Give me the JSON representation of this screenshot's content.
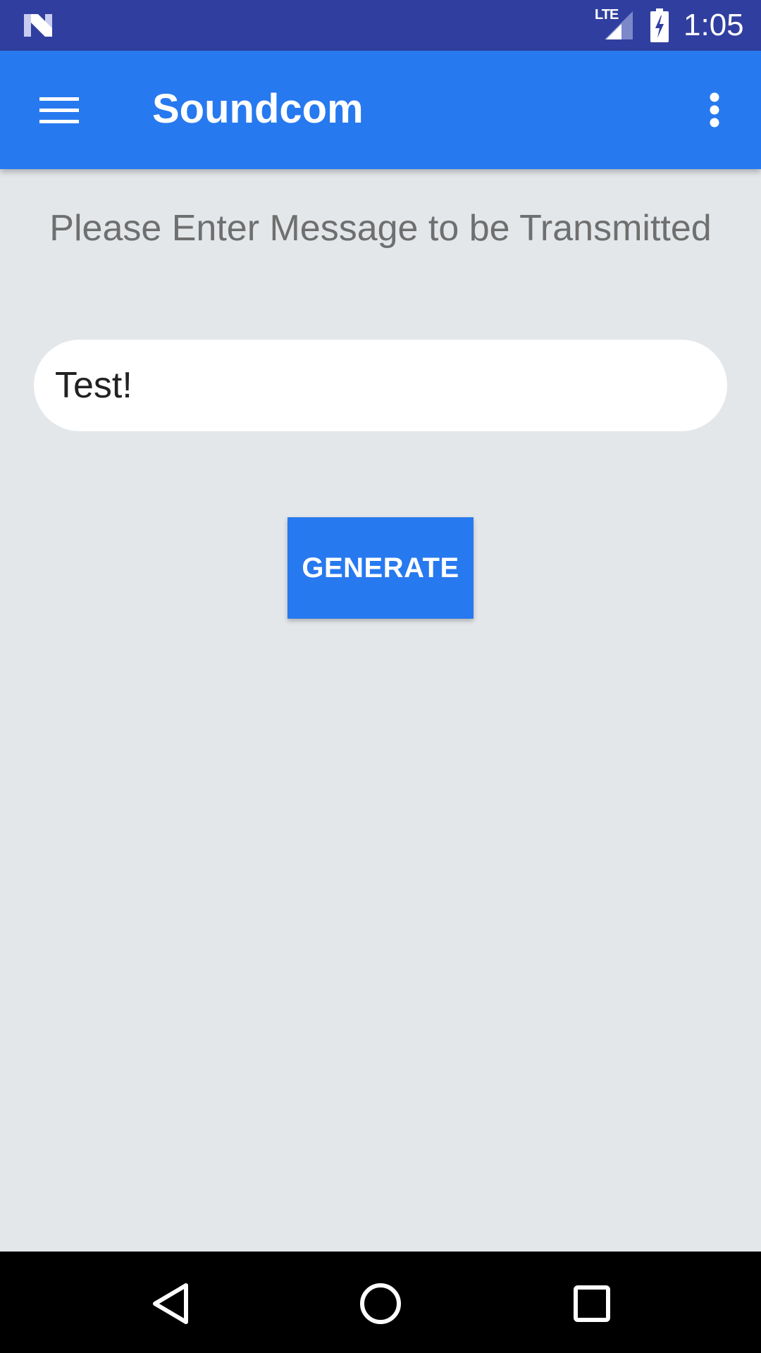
{
  "status_bar": {
    "network_label": "LTE",
    "time": "1:05",
    "icons": [
      "n-logo-icon",
      "signal-icon",
      "battery-charging-icon"
    ]
  },
  "app_bar": {
    "title": "Soundcom",
    "icons": [
      "menu-icon",
      "overflow-menu-icon"
    ]
  },
  "main": {
    "prompt": "Please Enter Message to be Transmitted",
    "message_input_value": "Test!",
    "generate_label": "GENERATE"
  },
  "nav_bar": {
    "icons": [
      "back-icon",
      "home-icon",
      "recents-icon"
    ]
  },
  "colors": {
    "status_bar": "#303f9f",
    "accent": "#2779ef",
    "background": "#e3e7ea",
    "prompt_text": "#6f6f6f"
  }
}
